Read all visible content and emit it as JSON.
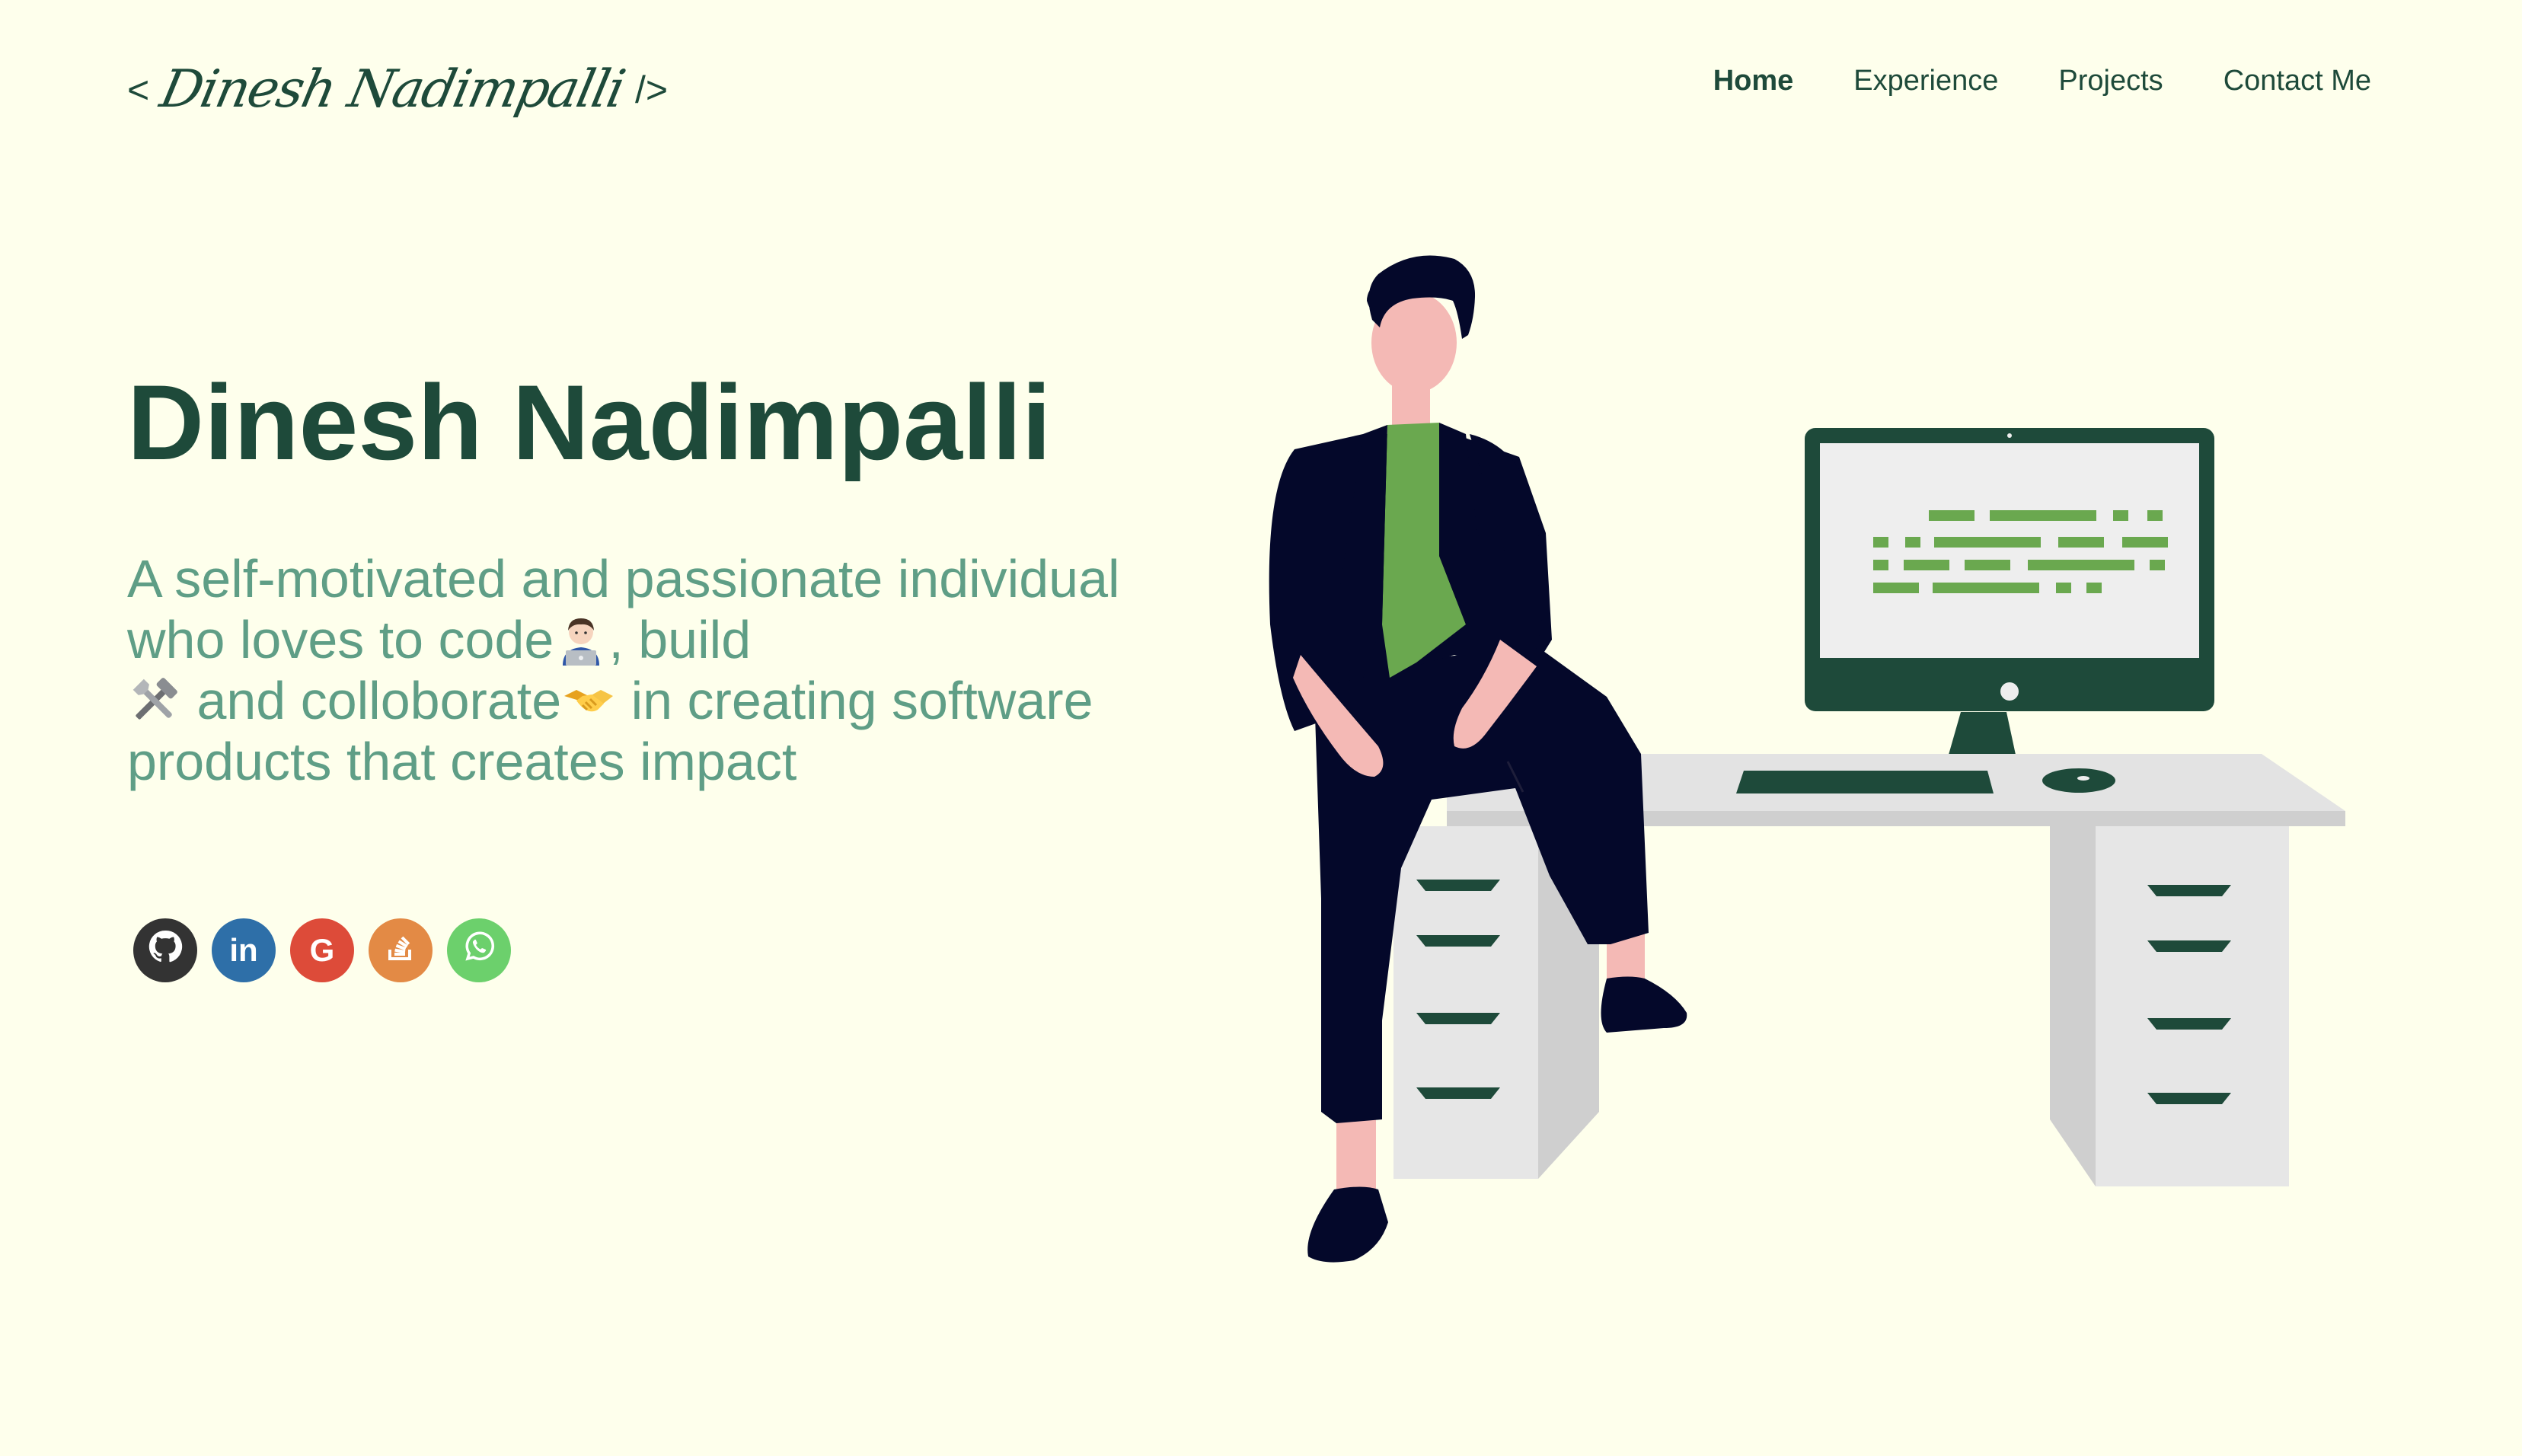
{
  "header": {
    "logo_open": "<",
    "logo_signature": "Dinesh Nadimpalli",
    "logo_close": "/>",
    "nav": [
      {
        "label": "Home",
        "active": true
      },
      {
        "label": "Experience",
        "active": false
      },
      {
        "label": "Projects",
        "active": false
      },
      {
        "label": "Contact Me",
        "active": false
      }
    ]
  },
  "hero": {
    "name": "Dinesh Nadimpalli",
    "desc_1": "A self-motivated and passionate individual who loves to code",
    "desc_2": ", build",
    "desc_3": " and colloborate",
    "desc_4": " in creating software products that creates impact",
    "emoji_1": "technologist-emoji",
    "emoji_2": "hammer-and-wrench-emoji",
    "emoji_3": "handshake-emoji"
  },
  "social": [
    {
      "name": "github",
      "icon": "github-icon",
      "color": "#333333"
    },
    {
      "name": "linkedin",
      "icon": "linkedin-icon",
      "color": "#2E6FA8",
      "glyph": "in"
    },
    {
      "name": "google",
      "icon": "google-icon",
      "color": "#DD4B39",
      "glyph": "G"
    },
    {
      "name": "stack-overflow",
      "icon": "stack-overflow-icon",
      "color": "#E38A45"
    },
    {
      "name": "whatsapp",
      "icon": "whatsapp-icon",
      "color": "#6CD06C"
    }
  ],
  "colors": {
    "background": "#FEFFEC",
    "heading": "#1E4A3A",
    "subtitle": "#5F9E86",
    "accent_green": "#6AA84F",
    "figure_dark": "#04082A",
    "skin": "#F4B9B5"
  }
}
